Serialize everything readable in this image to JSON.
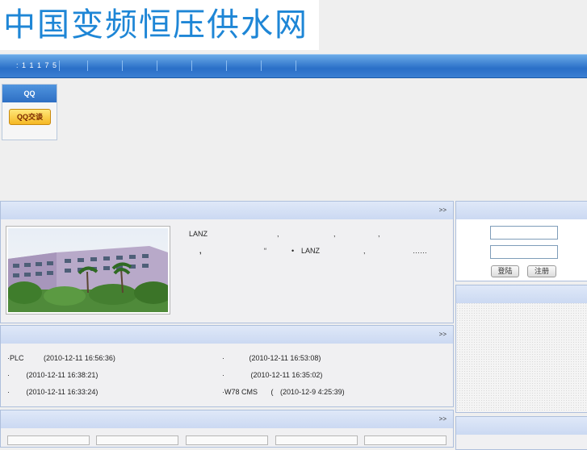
{
  "header": {
    "logo_text": "中国变频恒压供水网"
  },
  "nav": {
    "hotline": ": 1 1 1 7 5"
  },
  "qq": {
    "title": "QQ",
    "button_label": "QQ交谈"
  },
  "intro": {
    "more": ">>",
    "line1": [
      "LANZ",
      ",",
      ",",
      ","
    ],
    "line2": [
      ",",
      "“",
      "•",
      "LANZ",
      ",",
      "……"
    ]
  },
  "news": {
    "more": ">>",
    "items": [
      {
        "title": "·PLC",
        "date": "(2010-12-11 16:56:36)"
      },
      {
        "title": "·",
        "date": "(2010-12-11 16:53:08)"
      },
      {
        "title": "·",
        "date": "(2010-12-11 16:38:21)"
      },
      {
        "title": "·",
        "date": "(2010-12-11 16:35:02)"
      },
      {
        "title": "·",
        "date": "(2010-12-11 16:33:24)"
      },
      {
        "title": "·W78 CMS",
        "extra": "(",
        "date": "(2010-12-9 4:25:39)"
      }
    ]
  },
  "products": {
    "more": ">>"
  },
  "login": {
    "login_label": "登陆",
    "register_label": "注册"
  }
}
